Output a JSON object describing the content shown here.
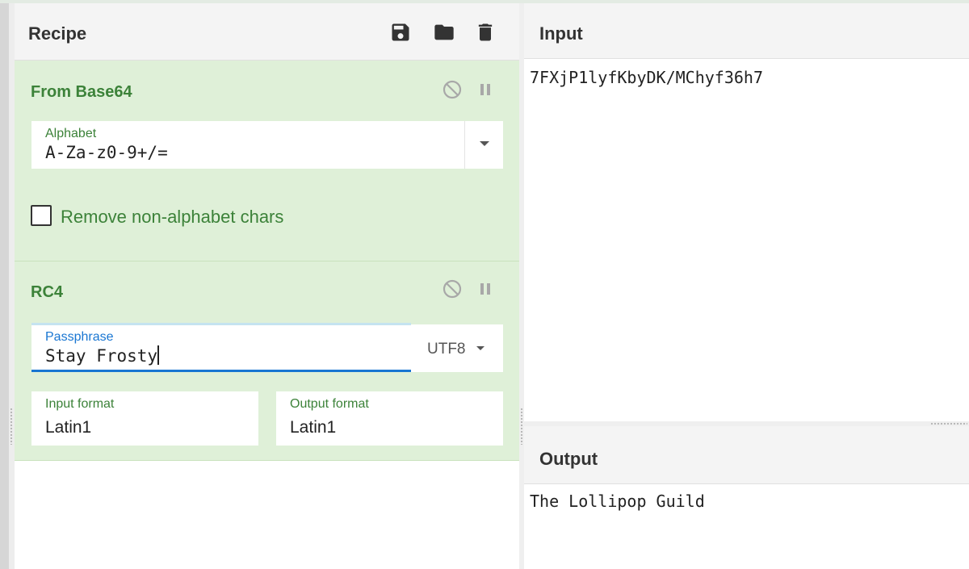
{
  "recipe": {
    "title": "Recipe",
    "icons": [
      "save-icon",
      "folder-icon",
      "trash-icon"
    ]
  },
  "operations": {
    "from_base64": {
      "title": "From Base64",
      "alphabet_label": "Alphabet",
      "alphabet_value": "A-Za-z0-9+/=",
      "remove_non_alphabet_label": "Remove non-alphabet chars",
      "remove_non_alphabet_checked": false
    },
    "rc4": {
      "title": "RC4",
      "passphrase_label": "Passphrase",
      "passphrase_value": "Stay Frosty",
      "encoding": "UTF8",
      "input_format_label": "Input format",
      "input_format_value": "Latin1",
      "output_format_label": "Output format",
      "output_format_value": "Latin1"
    }
  },
  "input": {
    "title": "Input",
    "value": "7FXjP1lyfKbyDK/MChyf36h7"
  },
  "output": {
    "title": "Output",
    "value": "The Lollipop Guild"
  },
  "colors": {
    "op_background": "#dff0d8",
    "op_accent": "#3c8239",
    "focus_blue": "#1976d2",
    "icon_grey": "#a8a8a8"
  }
}
